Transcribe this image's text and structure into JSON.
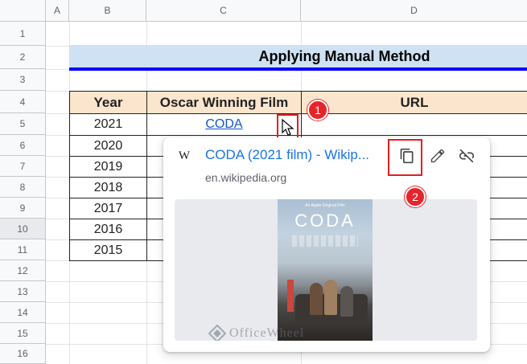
{
  "columns": [
    "A",
    "B",
    "C",
    "D"
  ],
  "rows": [
    "1",
    "2",
    "3",
    "4",
    "5",
    "6",
    "7",
    "8",
    "9",
    "10",
    "11",
    "12",
    "13",
    "14",
    "15",
    "16"
  ],
  "title": "Applying Manual Method",
  "table": {
    "headers": [
      "Year",
      "Oscar Winning Film",
      "URL"
    ],
    "years": [
      "2021",
      "2020",
      "2019",
      "2018",
      "2017",
      "2016",
      "2015"
    ],
    "first_film": "CODA"
  },
  "popup": {
    "favicon": "W",
    "link_title": "CODA (2021 film) - Wikip...",
    "domain": "en.wikipedia.org",
    "preview": {
      "studio": "An Apple Original Film",
      "poster_title": "CODA"
    },
    "actions": [
      "copy-link-icon",
      "edit-link-icon",
      "unlink-icon"
    ]
  },
  "annotations": [
    "1",
    "2"
  ],
  "watermark": "OfficeWheel",
  "colors": {
    "title_underline": "#0000ff",
    "header_fill": "#fce5cd",
    "title_fill": "#cfe2f3",
    "link": "#1155cc",
    "badge": "#e7242a"
  }
}
